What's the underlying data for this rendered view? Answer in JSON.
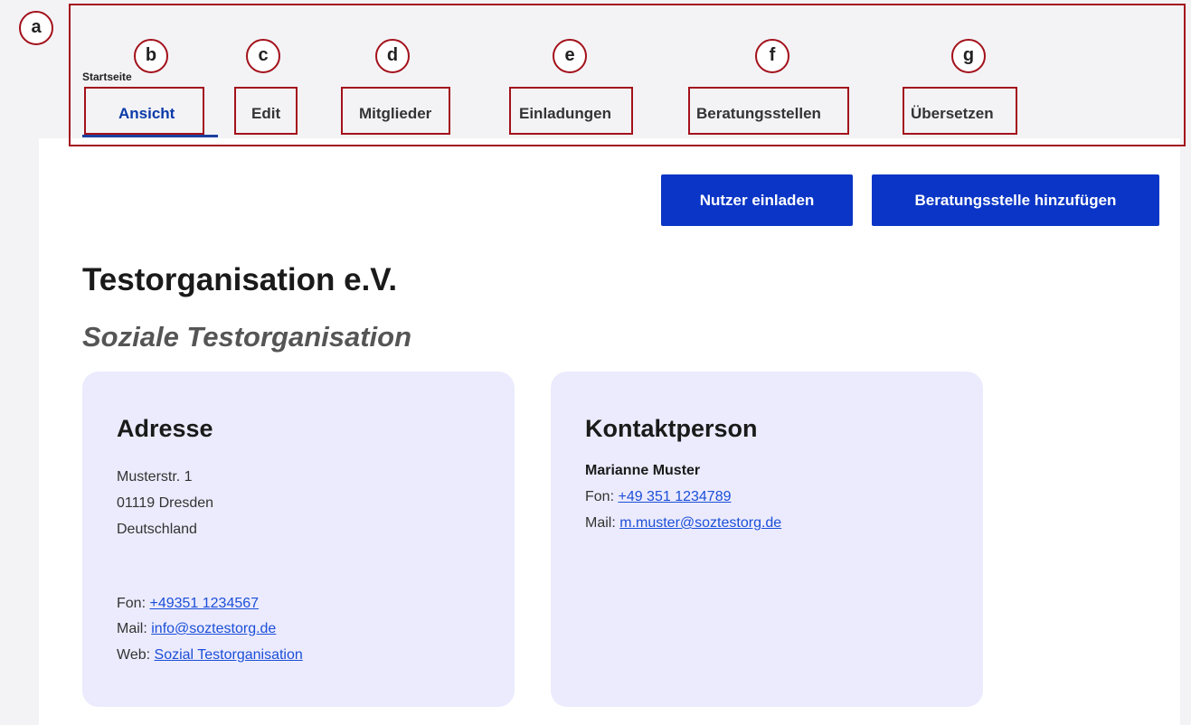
{
  "breadcrumb": "Startseite",
  "tabs": [
    {
      "label": "Ansicht",
      "active": true
    },
    {
      "label": "Edit"
    },
    {
      "label": "Mitglieder"
    },
    {
      "label": "Einladungen"
    },
    {
      "label": "Beratungsstellen"
    },
    {
      "label": "Übersetzen"
    }
  ],
  "annotations": [
    "a",
    "b",
    "c",
    "d",
    "e",
    "f",
    "g"
  ],
  "actions": {
    "invite_label": "Nutzer einladen",
    "add_office_label": "Beratungsstelle hinzufügen"
  },
  "organization": {
    "title": "Testorganisation e.V.",
    "subtitle": "Soziale Testorganisation"
  },
  "address_card": {
    "heading": "Adresse",
    "street": "Musterstr. 1",
    "city": "01119 Dresden",
    "country": "Deutschland",
    "phone_label": "Fon:",
    "phone": "+49351 1234567",
    "mail_label": "Mail:",
    "mail": "info@soztestorg.de",
    "web_label": "Web:",
    "web": "Sozial Testorganisation"
  },
  "contact_card": {
    "heading": "Kontaktperson",
    "name": "Marianne Muster",
    "phone_label": "Fon:",
    "phone": "+49 351 1234789",
    "mail_label": "Mail:",
    "mail": "m.muster@soztestorg.de"
  },
  "colors": {
    "accent": "#0a35c6",
    "annotation": "#a3111b",
    "card_bg": "#ecebfd",
    "link": "#1b4fd8"
  }
}
